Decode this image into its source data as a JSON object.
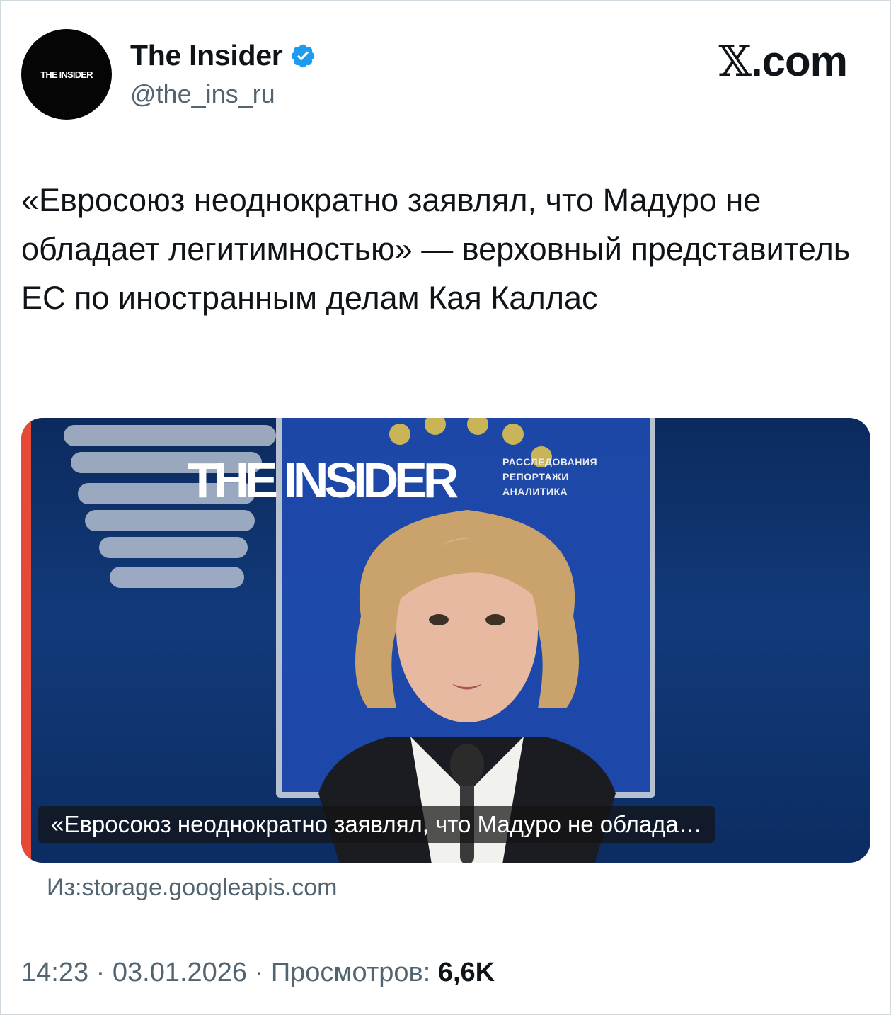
{
  "author": {
    "avatar_text": "THE INSIDER",
    "display_name": "The Insider",
    "handle": "@the_ins_ru",
    "verified": true,
    "verified_color": "#1d9bf0"
  },
  "site_label": "X.com",
  "tweet": {
    "text": "«Евросоюз неоднократно заявлял, что Мадуро не обладает легитимностью» — верховный представитель ЕС по иностранным делам Кая Каллас"
  },
  "media": {
    "brand": "THE INSIDER",
    "tagline": [
      "РАССЛЕДОВАНИЯ",
      "РЕПОРТАЖИ",
      "АНАЛИТИКА"
    ],
    "caption": "«Евросоюз неоднократно заявлял, что Мадуро не облада…",
    "accent_color": "#e64a36"
  },
  "source": "Из:storage.googleapis.com",
  "meta": {
    "time": "14:23",
    "date": "03.01.2026",
    "views_label": "Просмотров:",
    "views": "6,6K"
  }
}
